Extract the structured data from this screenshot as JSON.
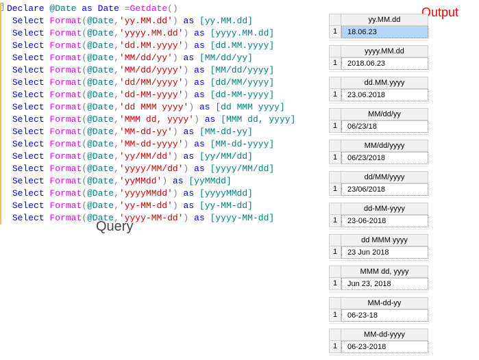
{
  "labels": {
    "query": "Query",
    "output": "Output"
  },
  "code": {
    "lines": [
      {
        "t": "declare",
        "text": "Declare @Date as Date =Getdate()"
      },
      {
        "t": "select",
        "fmt": "'yy.MM.dd'",
        "alias": "[yy.MM.dd]"
      },
      {
        "t": "select",
        "fmt": "'yyyy.MM.dd'",
        "alias": "[yyyy.MM.dd]"
      },
      {
        "t": "select",
        "fmt": "'dd.MM.yyyy'",
        "alias": "[dd.MM.yyyy]"
      },
      {
        "t": "select",
        "fmt": "'MM/dd/yy'",
        "alias": "[MM/dd/yy]"
      },
      {
        "t": "select",
        "fmt": "'MM/dd/yyyy'",
        "alias": "[MM/dd/yyyy]"
      },
      {
        "t": "select",
        "fmt": "'dd/MM/yyyy'",
        "alias": "[dd/MM/yyyy]"
      },
      {
        "t": "select",
        "fmt": "'dd-MM-yyyy'",
        "alias": "[dd-MM-yyyy]"
      },
      {
        "t": "select",
        "fmt": "'dd MMM yyyy'",
        "alias": "[dd MMM yyyy]"
      },
      {
        "t": "select",
        "fmt": "'MMM dd, yyyy'",
        "alias": "[MMM dd, yyyy]"
      },
      {
        "t": "select",
        "fmt": "'MM-dd-yy'",
        "alias": "[MM-dd-yy]"
      },
      {
        "t": "select",
        "fmt": "'MM-dd-yyyy'",
        "alias": "[MM-dd-yyyy]"
      },
      {
        "t": "select",
        "fmt": "'yy/MM/dd'",
        "alias": "[yy/MM/dd]"
      },
      {
        "t": "select",
        "fmt": "'yyyy/MM/dd'",
        "alias": "[yyyy/MM/dd]"
      },
      {
        "t": "select",
        "fmt": "'yyMMdd'",
        "alias": "[yyMMdd]"
      },
      {
        "t": "select",
        "fmt": "'yyyyMMdd'",
        "alias": "[yyyyMMdd]"
      },
      {
        "t": "select",
        "fmt": "'yy-MM-dd'",
        "alias": "[yy-MM-dd]"
      },
      {
        "t": "select",
        "fmt": "'yyyy-MM-dd'",
        "alias": "[yyyy-MM-dd]"
      }
    ],
    "tokens": {
      "declare": "Declare",
      "at_date": "@Date",
      "as": "as",
      "date_type": "Date",
      "eq": "=",
      "getdate": "Getdate",
      "select": "Select",
      "format": "Format",
      "lparen": "(",
      "rparen": ")",
      "comma": ","
    }
  },
  "results": [
    {
      "col": "yy.MM.dd",
      "val": "18.06.23",
      "selected": true
    },
    {
      "col": "yyyy.MM.dd",
      "val": "2018.06.23"
    },
    {
      "col": "dd.MM.yyyy",
      "val": "23.06.2018"
    },
    {
      "col": "MM/dd/yy",
      "val": "06/23/18"
    },
    {
      "col": "MM/dd/yyyy",
      "val": "06/23/2018"
    },
    {
      "col": "dd/MM/yyyy",
      "val": "23/06/2018"
    },
    {
      "col": "dd-MM-yyyy",
      "val": "23-06-2018"
    },
    {
      "col": "dd MMM yyyy",
      "val": "23 Jun 2018"
    },
    {
      "col": "MMM dd, yyyy",
      "val": "Jun 23, 2018"
    },
    {
      "col": "MM-dd-yy",
      "val": "06-23-18"
    },
    {
      "col": "MM-dd-yyyy",
      "val": "06-23-2018"
    }
  ],
  "rownum": "1",
  "collapse_glyph": "-"
}
